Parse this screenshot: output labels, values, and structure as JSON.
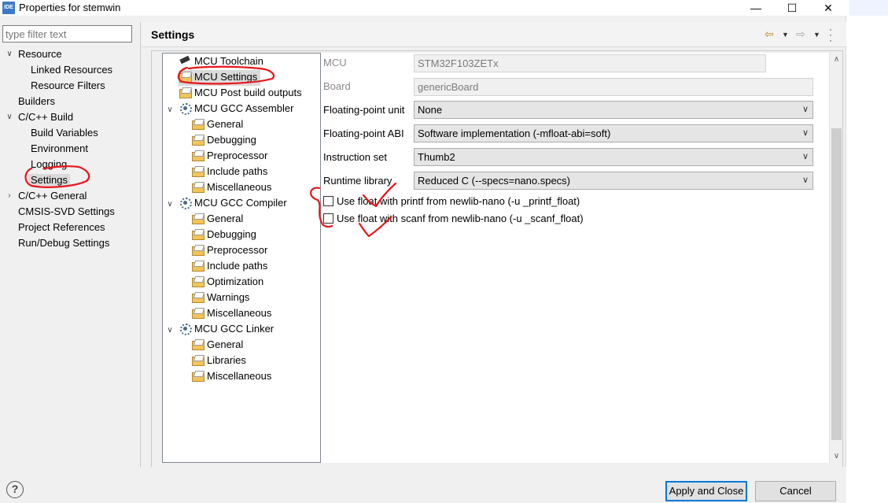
{
  "window": {
    "title": "Properties for stemwin",
    "app_icon_text": "IDE"
  },
  "left": {
    "filter_placeholder": "type filter text",
    "items": [
      {
        "label": "Resource",
        "expanded": true
      },
      {
        "label": "Linked Resources"
      },
      {
        "label": "Resource Filters"
      },
      {
        "label": "Builders"
      },
      {
        "label": "C/C++ Build",
        "expanded": true
      },
      {
        "label": "Build Variables"
      },
      {
        "label": "Environment"
      },
      {
        "label": "Logging"
      },
      {
        "label": "Settings",
        "selected": true
      },
      {
        "label": "C/C++ General",
        "expanded": false
      },
      {
        "label": "CMSIS-SVD Settings"
      },
      {
        "label": "Project References"
      },
      {
        "label": "Run/Debug Settings"
      }
    ]
  },
  "page": {
    "title": "Settings"
  },
  "tool_tree": [
    {
      "label": "MCU Toolchain"
    },
    {
      "label": "MCU Settings",
      "selected": true
    },
    {
      "label": "MCU Post build outputs"
    },
    {
      "label": "MCU GCC Assembler"
    },
    {
      "label": "General"
    },
    {
      "label": "Debugging"
    },
    {
      "label": "Preprocessor"
    },
    {
      "label": "Include paths"
    },
    {
      "label": "Miscellaneous"
    },
    {
      "label": "MCU GCC Compiler"
    },
    {
      "label": "General"
    },
    {
      "label": "Debugging"
    },
    {
      "label": "Preprocessor"
    },
    {
      "label": "Include paths"
    },
    {
      "label": "Optimization"
    },
    {
      "label": "Warnings"
    },
    {
      "label": "Miscellaneous"
    },
    {
      "label": "MCU GCC Linker"
    },
    {
      "label": "General"
    },
    {
      "label": "Libraries"
    },
    {
      "label": "Miscellaneous"
    }
  ],
  "settings": {
    "mcu_label": "MCU",
    "mcu_value": "STM32F103ZETx",
    "board_label": "Board",
    "board_value": "genericBoard",
    "fpu_label": "Floating-point unit",
    "fpu_value": "None",
    "fpabi_label": "Floating-point ABI",
    "fpabi_value": "Software implementation (-mfloat-abi=soft)",
    "iset_label": "Instruction set",
    "iset_value": "Thumb2",
    "runtime_label": "Runtime library",
    "runtime_value": "Reduced C (--specs=nano.specs)",
    "printf_label": "Use float with printf from newlib-nano (-u _printf_float)",
    "printf_checked": false,
    "scanf_label": "Use float with scanf from newlib-nano (-u _scanf_float)",
    "scanf_checked": false
  },
  "buttons": {
    "apply_close": "Apply and Close",
    "cancel": "Cancel",
    "help": "?"
  },
  "annotation_color": "#e8161d"
}
